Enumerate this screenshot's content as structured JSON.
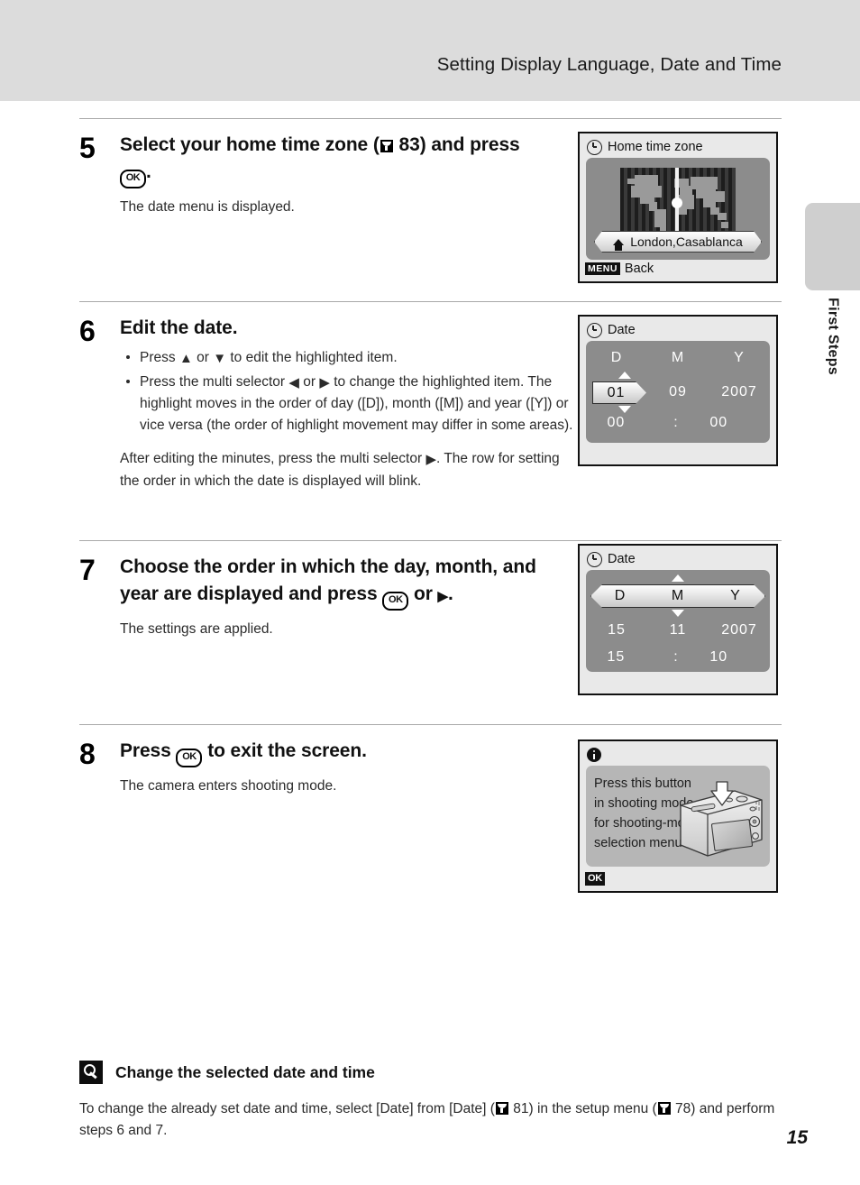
{
  "header": {
    "title": "Setting Display Language, Date and Time"
  },
  "chapter_tab": {
    "label": "First Steps"
  },
  "page_number": "15",
  "steps": [
    {
      "num": "5",
      "head_a": "Select your home time zone (",
      "head_ref": "83",
      "head_b": ") and press",
      "head_c": ".",
      "sub": "The date menu is displayed.",
      "screen": {
        "kind": "home-time-zone",
        "title": "Home time zone",
        "city": "London,Casablanca",
        "footer_badge": "MENU",
        "footer_label": "Back"
      }
    },
    {
      "num": "6",
      "head": "Edit the date.",
      "bullets": [
        {
          "a": "Press ",
          "b": " or ",
          "c": " to edit the highlighted item."
        },
        {
          "a": "Press the multi selector ",
          "b": " or ",
          "c": " to change the highlighted item. The highlight moves in the order of day ([D]), month ([M]) and year ([Y]) or vice versa (the order of highlight movement may differ in some areas)."
        }
      ],
      "para_a": "After editing the minutes, press the multi selector ",
      "para_b": ". The row for setting the order in which the date is displayed will blink.",
      "screen": {
        "kind": "date-edit",
        "title": "Date",
        "col_d": "D",
        "col_m": "M",
        "col_y": "Y",
        "day": "01",
        "month": "09",
        "year": "2007",
        "hour": "00",
        "sep": ":",
        "minute": "00"
      }
    },
    {
      "num": "7",
      "head_a": "Choose the order in which the day, month, and year are displayed and press ",
      "head_b": " or ",
      "head_c": ".",
      "sub": "The settings are applied.",
      "screen": {
        "kind": "date-order",
        "title": "Date",
        "col_d": "D",
        "col_m": "M",
        "col_y": "Y",
        "day": "15",
        "month": "11",
        "year": "2007",
        "hour": "15",
        "sep": ":",
        "minute": "10"
      }
    },
    {
      "num": "8",
      "head_a": "Press ",
      "head_b": " to exit the screen.",
      "sub": "The camera enters shooting mode.",
      "screen": {
        "kind": "info",
        "line1": "Press this button",
        "line2": "in shooting mode",
        "line3": "for shooting-mode",
        "line4": "selection menu.",
        "footer_badge": "OK"
      }
    }
  ],
  "note": {
    "title": "Change the selected date and time",
    "body_a": "To change the already set date and time, select [Date] from [Date] (",
    "ref1": "81",
    "body_b": ") in the setup menu (",
    "ref2": "78",
    "body_c": ") and perform steps 6 and 7."
  },
  "colors": {
    "header_band": "#dcdcdc",
    "tab": "#cfcfcf",
    "lcd_panel": "#8c8c8c",
    "rule": "#a9a9a9"
  }
}
